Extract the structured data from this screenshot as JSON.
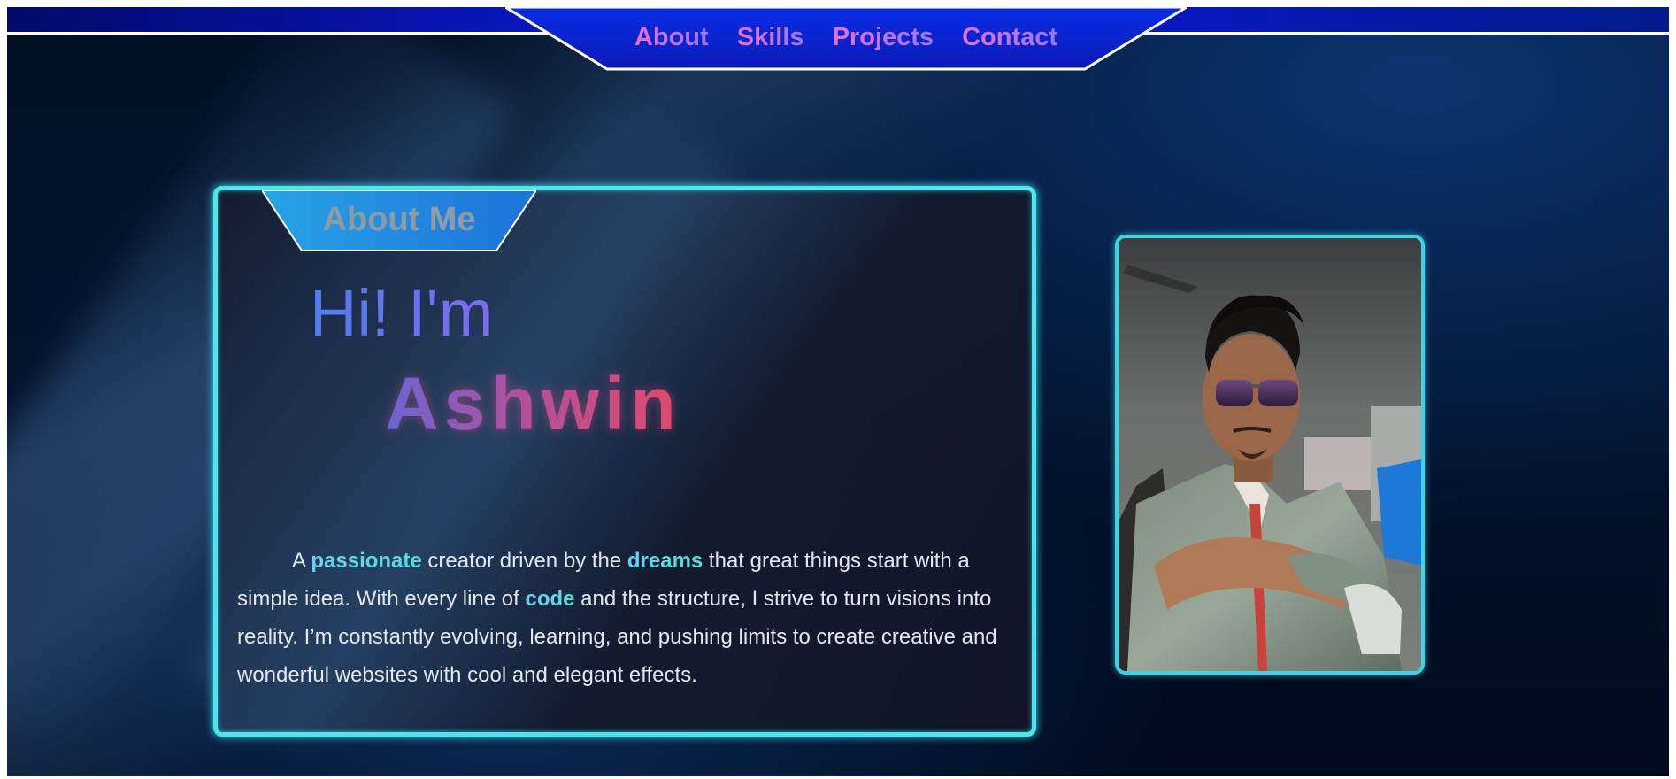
{
  "nav": {
    "items": [
      {
        "label": "About"
      },
      {
        "label": "Skills"
      },
      {
        "label": "Projects"
      },
      {
        "label": "Contact"
      }
    ]
  },
  "about": {
    "tab_label": "About Me",
    "greeting": "Hi! I'm",
    "name": "Ashwin",
    "bio": {
      "p1": "A ",
      "h1": "passionate",
      "p2": " creator driven by the ",
      "h2": "dreams",
      "p3": " that great things start with a simple idea. With every line of ",
      "h3": "code",
      "p4": " and the structure, I strive to turn visions into reality. I’m constantly evolving, learning, and pushing limits to create creative and wonderful websites with cool and elegant effects."
    }
  },
  "photo": {
    "alt": "Profile photo"
  },
  "colors": {
    "accent_cyan": "#4ee6ee",
    "nav_blue": "#0a18c8",
    "name_gradient_start": "#6a66d6",
    "name_gradient_end": "#e04a6c"
  }
}
